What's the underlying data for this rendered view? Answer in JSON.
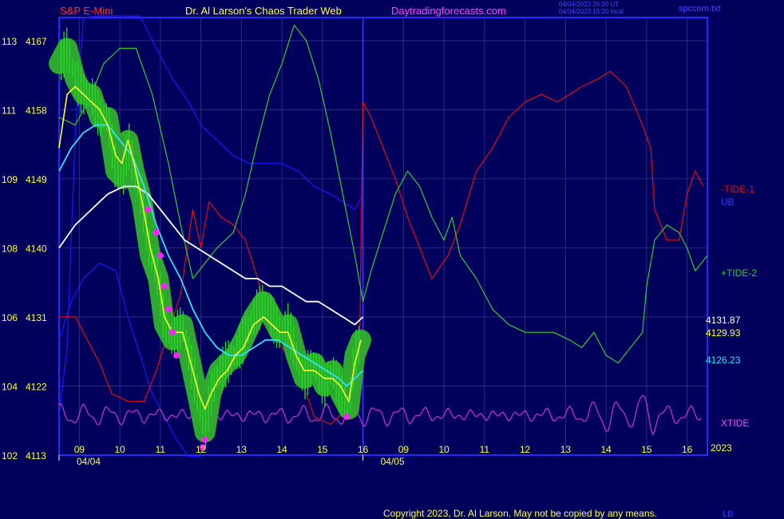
{
  "header": {
    "symbol": "S&P E-Mini",
    "author": "Dr. Al Larson's Chaos Trader Web",
    "site": "Daytradingforecasts.com",
    "stamp_utc": "04/04/2023 20:20 UT",
    "stamp_local": "04/04/2023 15:20 local",
    "filename": "spccom.txt"
  },
  "footer": {
    "copyright": "Copyright 2023, Dr. Al Larson. May not be copied by any means.",
    "corner": "LB"
  },
  "colors": {
    "background": "#00005c",
    "price_bars": "#22dd22",
    "price_glow": "#2fa82f",
    "yellow_line": "#ffff33",
    "cyan_line": "#33e0ff",
    "white_line": "#ffffff",
    "tide1": "#dd1111",
    "tide2": "#33cc33",
    "ub": "#1a1aff",
    "xtide": "#cc33cc",
    "markers": "#ff22ff"
  },
  "chart_data": {
    "type": "line",
    "title": "S&P E-Mini",
    "y_axis": {
      "ticks": [
        {
          "code": "113",
          "price": 4167
        },
        {
          "code": "111",
          "price": 4158
        },
        {
          "code": "109",
          "price": 4149
        },
        {
          "code": "108",
          "price": 4140
        },
        {
          "code": "106",
          "price": 4131
        },
        {
          "code": "104",
          "price": 4122
        },
        {
          "code": "102",
          "price": 4113
        }
      ],
      "range": [
        4113,
        4170
      ]
    },
    "x_axis": {
      "hours": [
        "09",
        "10",
        "11",
        "12",
        "13",
        "14",
        "15",
        "16",
        "09",
        "10",
        "11",
        "12",
        "13",
        "14",
        "15",
        "16"
      ],
      "dates": [
        "04/04",
        "04/05"
      ],
      "range": [
        8.5,
        24.5
      ],
      "year": "2023"
    },
    "right_labels": {
      "tide1": "-TIDE-1",
      "ub": "UB",
      "tide2": "+TIDE-2",
      "price1": "4131.87",
      "price2": "4129.93",
      "price3": "4126.23",
      "xtide": "XTIDE"
    },
    "series": [
      {
        "key": "price_path",
        "values": [
          [
            8.5,
            4164
          ],
          [
            8.7,
            4166
          ],
          [
            8.9,
            4162
          ],
          [
            9.1,
            4160
          ],
          [
            9.3,
            4160
          ],
          [
            9.5,
            4157
          ],
          [
            9.7,
            4157
          ],
          [
            9.9,
            4150
          ],
          [
            10.1,
            4149
          ],
          [
            10.2,
            4154
          ],
          [
            10.35,
            4150
          ],
          [
            10.55,
            4146
          ],
          [
            10.75,
            4139
          ],
          [
            10.95,
            4136
          ],
          [
            11.1,
            4130
          ],
          [
            11.3,
            4128
          ],
          [
            11.55,
            4130
          ],
          [
            11.75,
            4125
          ],
          [
            11.95,
            4120
          ],
          [
            12.1,
            4116
          ],
          [
            12.25,
            4121
          ],
          [
            12.45,
            4124
          ],
          [
            12.65,
            4125
          ],
          [
            12.85,
            4126
          ],
          [
            13.05,
            4128
          ],
          [
            13.3,
            4131
          ],
          [
            13.55,
            4133
          ],
          [
            13.75,
            4131
          ],
          [
            13.95,
            4129
          ],
          [
            14.15,
            4130
          ],
          [
            14.35,
            4126
          ],
          [
            14.55,
            4123
          ],
          [
            14.8,
            4125
          ],
          [
            15.05,
            4122
          ],
          [
            15.25,
            4124
          ],
          [
            15.45,
            4121
          ],
          [
            15.65,
            4119
          ],
          [
            15.8,
            4126
          ],
          [
            15.95,
            4128
          ]
        ]
      },
      {
        "key": "yellow",
        "values": [
          [
            8.5,
            4153
          ],
          [
            8.7,
            4160
          ],
          [
            8.9,
            4161
          ],
          [
            9.1,
            4160
          ],
          [
            9.3,
            4159
          ],
          [
            9.5,
            4158
          ],
          [
            9.7,
            4156
          ],
          [
            9.9,
            4152
          ],
          [
            10.05,
            4151
          ],
          [
            10.2,
            4154
          ],
          [
            10.35,
            4151
          ],
          [
            10.55,
            4146
          ],
          [
            10.75,
            4140
          ],
          [
            10.95,
            4136
          ],
          [
            11.1,
            4131
          ],
          [
            11.3,
            4129
          ],
          [
            11.55,
            4129
          ],
          [
            11.75,
            4125
          ],
          [
            11.95,
            4121
          ],
          [
            12.1,
            4119
          ],
          [
            12.25,
            4121
          ],
          [
            12.45,
            4123
          ],
          [
            12.65,
            4124
          ],
          [
            12.85,
            4126
          ],
          [
            13.05,
            4127
          ],
          [
            13.3,
            4130
          ],
          [
            13.55,
            4131
          ],
          [
            13.75,
            4130
          ],
          [
            13.95,
            4129
          ],
          [
            14.15,
            4129
          ],
          [
            14.35,
            4126
          ],
          [
            14.55,
            4124
          ],
          [
            14.8,
            4124
          ],
          [
            15.05,
            4123
          ],
          [
            15.25,
            4123
          ],
          [
            15.45,
            4122
          ],
          [
            15.65,
            4120
          ],
          [
            15.8,
            4125
          ],
          [
            15.95,
            4128
          ]
        ]
      },
      {
        "key": "cyan",
        "values": [
          [
            8.5,
            4150
          ],
          [
            8.8,
            4153
          ],
          [
            9.1,
            4155
          ],
          [
            9.4,
            4156
          ],
          [
            9.7,
            4156
          ],
          [
            10.0,
            4154
          ],
          [
            10.3,
            4152
          ],
          [
            10.6,
            4148
          ],
          [
            10.9,
            4143
          ],
          [
            11.2,
            4139
          ],
          [
            11.5,
            4136
          ],
          [
            11.8,
            4132
          ],
          [
            12.1,
            4129
          ],
          [
            12.4,
            4127
          ],
          [
            12.7,
            4126
          ],
          [
            13.0,
            4126
          ],
          [
            13.3,
            4127
          ],
          [
            13.6,
            4128
          ],
          [
            13.9,
            4128
          ],
          [
            14.2,
            4127
          ],
          [
            14.5,
            4126
          ],
          [
            14.8,
            4125
          ],
          [
            15.1,
            4124
          ],
          [
            15.4,
            4123
          ],
          [
            15.6,
            4122
          ],
          [
            15.8,
            4123
          ],
          [
            16.0,
            4124
          ]
        ]
      },
      {
        "key": "white",
        "values": [
          [
            8.5,
            4140
          ],
          [
            8.9,
            4143
          ],
          [
            9.3,
            4145
          ],
          [
            9.7,
            4147
          ],
          [
            10.1,
            4148
          ],
          [
            10.4,
            4148
          ],
          [
            10.7,
            4147
          ],
          [
            11.0,
            4145
          ],
          [
            11.3,
            4143
          ],
          [
            11.6,
            4141
          ],
          [
            11.9,
            4140
          ],
          [
            12.2,
            4139
          ],
          [
            12.5,
            4138
          ],
          [
            12.8,
            4137
          ],
          [
            13.1,
            4136
          ],
          [
            13.4,
            4136
          ],
          [
            13.7,
            4135
          ],
          [
            14.0,
            4135
          ],
          [
            14.3,
            4134
          ],
          [
            14.6,
            4133
          ],
          [
            14.9,
            4133
          ],
          [
            15.2,
            4132
          ],
          [
            15.5,
            4131
          ],
          [
            15.8,
            4130
          ],
          [
            16.0,
            4131
          ]
        ]
      },
      {
        "key": "tide1",
        "values": [
          [
            8.5,
            4131
          ],
          [
            8.9,
            4131
          ],
          [
            9.2,
            4128
          ],
          [
            9.5,
            4125
          ],
          [
            9.8,
            4121
          ],
          [
            10.2,
            4120
          ],
          [
            10.6,
            4120
          ],
          [
            10.9,
            4124
          ],
          [
            11.2,
            4129
          ],
          [
            11.5,
            4134
          ],
          [
            11.8,
            4145
          ],
          [
            12.0,
            4140
          ],
          [
            12.2,
            4146
          ],
          [
            12.5,
            4144
          ],
          [
            12.8,
            4143
          ],
          [
            13.1,
            4141
          ],
          [
            13.4,
            4136
          ],
          [
            13.7,
            4130
          ],
          [
            14.0,
            4127
          ],
          [
            14.4,
            4124
          ],
          [
            14.8,
            4118
          ],
          [
            15.2,
            4117
          ],
          [
            15.6,
            4119
          ],
          [
            15.9,
            4120
          ],
          [
            16.0,
            4159
          ],
          [
            16.2,
            4157
          ],
          [
            16.5,
            4153
          ],
          [
            16.8,
            4149
          ],
          [
            17.1,
            4144
          ],
          [
            17.4,
            4140
          ],
          [
            17.7,
            4136
          ],
          [
            18.1,
            4139
          ],
          [
            18.4,
            4143
          ],
          [
            18.8,
            4150
          ],
          [
            19.2,
            4153
          ],
          [
            19.6,
            4157
          ],
          [
            20.0,
            4159
          ],
          [
            20.4,
            4160
          ],
          [
            20.8,
            4159
          ],
          [
            21.1,
            4160
          ],
          [
            21.4,
            4161
          ],
          [
            21.8,
            4162
          ],
          [
            22.1,
            4163
          ],
          [
            22.5,
            4161
          ],
          [
            22.9,
            4156
          ],
          [
            23.1,
            4153
          ],
          [
            23.2,
            4145
          ],
          [
            23.5,
            4141
          ],
          [
            23.8,
            4141
          ],
          [
            24.0,
            4147
          ],
          [
            24.2,
            4150
          ],
          [
            24.4,
            4148
          ]
        ]
      },
      {
        "key": "tide2",
        "values": [
          [
            8.5,
            4157
          ],
          [
            8.9,
            4156
          ],
          [
            9.3,
            4160
          ],
          [
            9.6,
            4164
          ],
          [
            10.0,
            4166
          ],
          [
            10.4,
            4166
          ],
          [
            10.8,
            4160
          ],
          [
            11.2,
            4151
          ],
          [
            11.5,
            4143
          ],
          [
            11.8,
            4136
          ],
          [
            12.1,
            4138
          ],
          [
            12.4,
            4140
          ],
          [
            12.8,
            4142
          ],
          [
            13.1,
            4147
          ],
          [
            13.4,
            4154
          ],
          [
            13.7,
            4160
          ],
          [
            14.0,
            4164
          ],
          [
            14.3,
            4169
          ],
          [
            14.6,
            4167
          ],
          [
            14.9,
            4162
          ],
          [
            15.2,
            4155
          ],
          [
            15.5,
            4147
          ],
          [
            15.8,
            4139
          ],
          [
            16.0,
            4133
          ],
          [
            16.2,
            4137
          ],
          [
            16.5,
            4142
          ],
          [
            16.8,
            4147
          ],
          [
            17.1,
            4150
          ],
          [
            17.4,
            4148
          ],
          [
            17.7,
            4144
          ],
          [
            18.0,
            4141
          ],
          [
            18.2,
            4144
          ],
          [
            18.4,
            4139
          ],
          [
            18.8,
            4136
          ],
          [
            19.2,
            4132
          ],
          [
            19.6,
            4130
          ],
          [
            20.0,
            4129
          ],
          [
            20.3,
            4129
          ],
          [
            20.7,
            4129
          ],
          [
            21.1,
            4128
          ],
          [
            21.4,
            4127
          ],
          [
            21.7,
            4129
          ],
          [
            22.0,
            4126
          ],
          [
            22.3,
            4125
          ],
          [
            22.6,
            4127
          ],
          [
            22.9,
            4129
          ],
          [
            23.0,
            4135
          ],
          [
            23.2,
            4141
          ],
          [
            23.5,
            4143
          ],
          [
            23.8,
            4142
          ],
          [
            24.0,
            4140
          ],
          [
            24.2,
            4137
          ],
          [
            24.5,
            4139
          ]
        ]
      },
      {
        "key": "ub",
        "values": [
          [
            8.5,
            4118
          ],
          [
            8.7,
            4127
          ],
          [
            8.9,
            4155
          ],
          [
            9.1,
            4170
          ],
          [
            9.5,
            4180
          ],
          [
            10.0,
            4185
          ],
          [
            10.5,
            4175
          ],
          [
            10.9,
            4166
          ],
          [
            11.3,
            4162
          ],
          [
            11.7,
            4159
          ],
          [
            12.0,
            4156
          ],
          [
            12.4,
            4154
          ],
          [
            12.8,
            4152
          ],
          [
            13.2,
            4151
          ],
          [
            13.6,
            4151
          ],
          [
            14.0,
            4151
          ],
          [
            14.4,
            4150
          ],
          [
            14.8,
            4148
          ],
          [
            15.2,
            4147
          ],
          [
            15.5,
            4146
          ],
          [
            15.8,
            4145
          ],
          [
            16.0,
            4147
          ]
        ]
      },
      {
        "key": "lb",
        "values": [
          [
            8.5,
            4128
          ],
          [
            8.8,
            4133
          ],
          [
            9.1,
            4136
          ],
          [
            9.5,
            4138
          ],
          [
            9.9,
            4137
          ],
          [
            10.2,
            4131
          ],
          [
            10.5,
            4126
          ],
          [
            10.8,
            4121
          ],
          [
            11.1,
            4118
          ],
          [
            11.4,
            4115
          ],
          [
            11.7,
            4112
          ],
          [
            12.0,
            4110
          ]
        ]
      }
    ]
  }
}
